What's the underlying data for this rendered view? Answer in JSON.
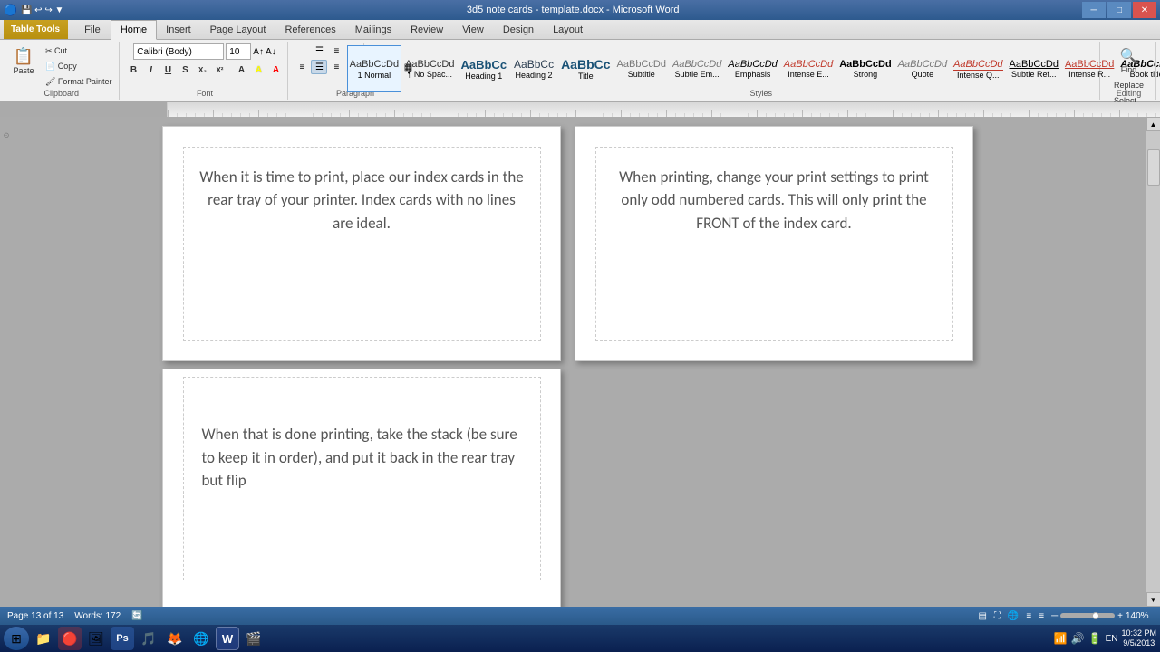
{
  "titlebar": {
    "title": "3d5 note cards - template.docx - Microsoft Word",
    "table_tools_label": "Table Tools",
    "minimize": "─",
    "maximize": "□",
    "close": "✕"
  },
  "ribbon": {
    "tabs": [
      "File",
      "Home",
      "Insert",
      "Page Layout",
      "References",
      "Mailings",
      "Review",
      "View",
      "Design",
      "Layout"
    ],
    "active_tab": "Home",
    "table_tools_tab": "Table Tools",
    "font_name": "Calibri (Body)",
    "font_size": "10",
    "quick_access": [
      "💾",
      "↩",
      "↪"
    ],
    "paste_label": "Paste",
    "clipboard_label": "Clipboard",
    "font_label": "Font",
    "paragraph_label": "Paragraph",
    "styles_label": "Styles",
    "editing_label": "Editing",
    "styles": [
      {
        "label": "1 Normal",
        "preview": "AaBbCcDd",
        "active": true
      },
      {
        "label": "No Spac...",
        "preview": "AaBbCcDd"
      },
      {
        "label": "Heading 1",
        "preview": "AaBbCc"
      },
      {
        "label": "Heading 2",
        "preview": "AaBbCc"
      },
      {
        "label": "Title",
        "preview": "AaBbCc"
      },
      {
        "label": "Subtitle",
        "preview": "AaBbCcDd"
      },
      {
        "label": "Subtle Em...",
        "preview": "AaBbCcDd"
      },
      {
        "label": "Emphasis",
        "preview": "AaBbCcDd"
      },
      {
        "label": "Intense E...",
        "preview": "AaBbCcDd"
      },
      {
        "label": "Strong",
        "preview": "AaBbCcDd"
      },
      {
        "label": "Quote",
        "preview": "AaBbCcDd"
      },
      {
        "label": "Intense Q...",
        "preview": "AaBbCcDd"
      },
      {
        "label": "Subtle Ref...",
        "preview": "AaBbCcDd"
      },
      {
        "label": "Intense R...",
        "preview": "AaBbCcDd"
      },
      {
        "label": "Book title",
        "preview": "AaBbCcDd"
      }
    ],
    "find_label": "Find",
    "replace_label": "Replace",
    "select_label": "Select"
  },
  "cards": {
    "card1": {
      "text": "When it is time to print, place our index cards in the rear tray of your printer.  Index cards with no lines are ideal."
    },
    "card2": {
      "text": "When printing, change your print settings to print only odd numbered cards.  This will only print the FRONT of the index card."
    },
    "card3": {
      "text": "When that is done printing,  take the stack (be sure to keep it in order), and put it back in the rear tray but flip"
    }
  },
  "statusbar": {
    "page_info": "Page 13 of 13",
    "words": "Words: 172",
    "zoom": "140%",
    "track_changes": "🔄"
  },
  "taskbar": {
    "time": "10:32 PM",
    "date": "9/5/2013",
    "apps": [
      {
        "icon": "⊞",
        "name": "start"
      },
      {
        "icon": "📁",
        "name": "explorer"
      },
      {
        "icon": "🔴",
        "name": "photoshop-alt"
      },
      {
        "icon": "📂",
        "name": "lightroom"
      },
      {
        "icon": "Ps",
        "name": "photoshop"
      },
      {
        "icon": "🎵",
        "name": "media"
      },
      {
        "icon": "🦊",
        "name": "firefox"
      },
      {
        "icon": "🌐",
        "name": "chrome"
      },
      {
        "icon": "W",
        "name": "word"
      },
      {
        "icon": "🎬",
        "name": "vlc"
      }
    ]
  }
}
